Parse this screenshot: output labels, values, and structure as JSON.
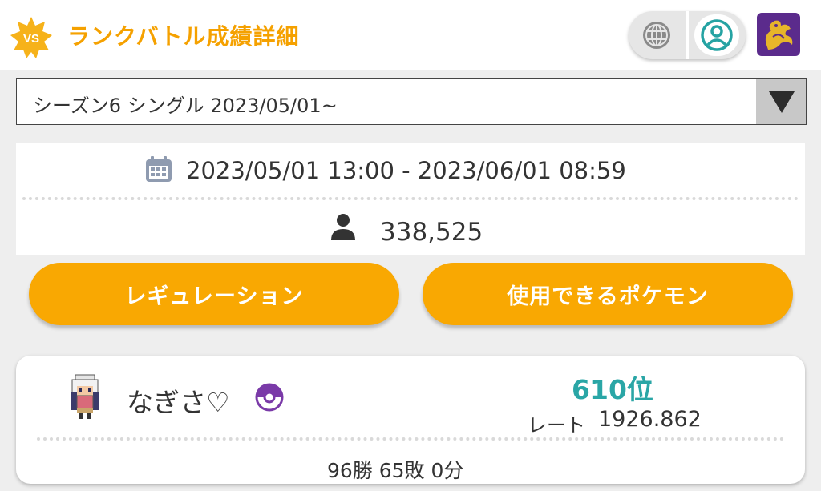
{
  "header": {
    "badge_text": "VS",
    "title": "ランクバトル成績詳細",
    "icons": {
      "globe": "globe-icon",
      "profile": "profile-icon",
      "logo": "dragon-logo-icon"
    },
    "colors": {
      "accent": "#f5a100",
      "teal": "#25a3a3",
      "logo_bg": "#5b2b8c"
    }
  },
  "season_select": {
    "selected": "シーズン6 シングル 2023/05/01~",
    "icon": "dropdown-arrow-icon"
  },
  "season_info": {
    "period": "2023/05/01 13:00 - 2023/06/01 08:59",
    "players": "338,525",
    "icons": {
      "period": "calendar-icon",
      "players": "person-icon"
    }
  },
  "buttons": {
    "regulation": "レギュレーション",
    "usable_pokemon": "使用できるポケモン"
  },
  "player": {
    "name": "なぎさ♡",
    "rank": "610位",
    "rate_label": "レート",
    "rate_value": "1926.862",
    "record": "96勝 65敗 0分",
    "icons": {
      "avatar": "trainer-sprite-icon",
      "ball": "poke-ball-icon"
    }
  }
}
